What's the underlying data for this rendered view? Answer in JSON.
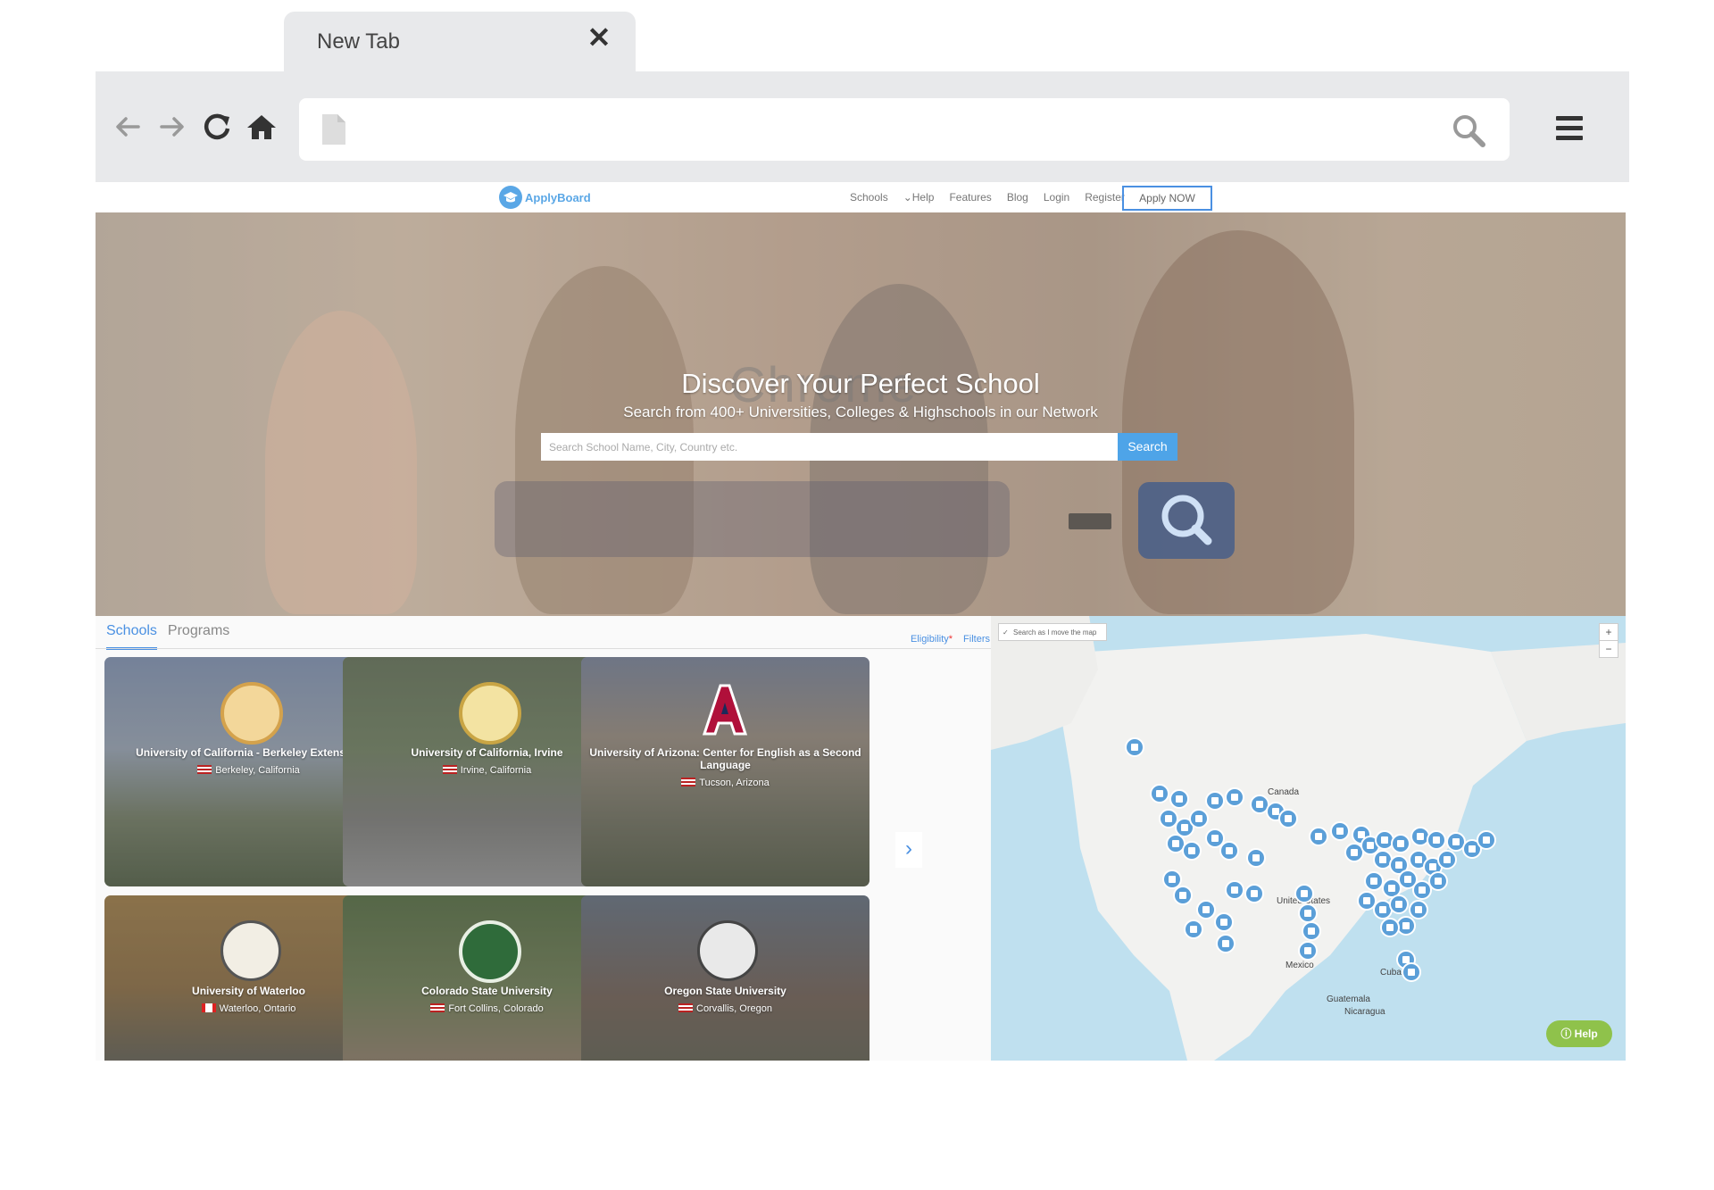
{
  "browser": {
    "tab_title": "New Tab",
    "tab_close": "✕"
  },
  "site": {
    "logo_text": "ApplyBoard",
    "nav": [
      "Schools",
      "Help",
      "Features",
      "Blog",
      "Login",
      "Register"
    ],
    "apply_button": "Apply NOW"
  },
  "hero": {
    "title": "Discover Your Perfect School",
    "subtitle": "Search from 400+ Universities, Colleges & Highschools in our Network",
    "search_placeholder": "Search School Name, City, Country etc.",
    "search_button": "Search",
    "ghost_word": "Chrome"
  },
  "results": {
    "tabs": [
      "Schools",
      "Programs"
    ],
    "filters": [
      "Eligibility",
      "Filters"
    ],
    "cards": [
      {
        "name": "University of California - Berkeley Extension",
        "location": "Berkeley, California",
        "flag": "US"
      },
      {
        "name": "University of California, Irvine",
        "location": "Irvine, California",
        "flag": "US"
      },
      {
        "name": "University of Arizona: Center for English as a Second Language",
        "location": "Tucson, Arizona",
        "flag": "US"
      },
      {
        "name": "University of Waterloo",
        "location": "Waterloo, Ontario",
        "flag": "CA"
      },
      {
        "name": "Colorado State University",
        "location": "Fort Collins, Colorado",
        "flag": "US"
      },
      {
        "name": "Oregon State University",
        "location": "Corvallis, Oregon",
        "flag": "US"
      }
    ]
  },
  "map": {
    "search_checkbox": "Search as I move the map",
    "zoom_in": "+",
    "zoom_out": "−",
    "labels": [
      "Canada",
      "United States",
      "Mexico",
      "Cuba",
      "Guatemala",
      "Nicaragua"
    ],
    "help": "Help"
  },
  "colors": {
    "accent": "#4a90e2",
    "search_button": "#4ea4e8",
    "help_button": "#8fc24b",
    "pin": "#5b9fd8"
  }
}
